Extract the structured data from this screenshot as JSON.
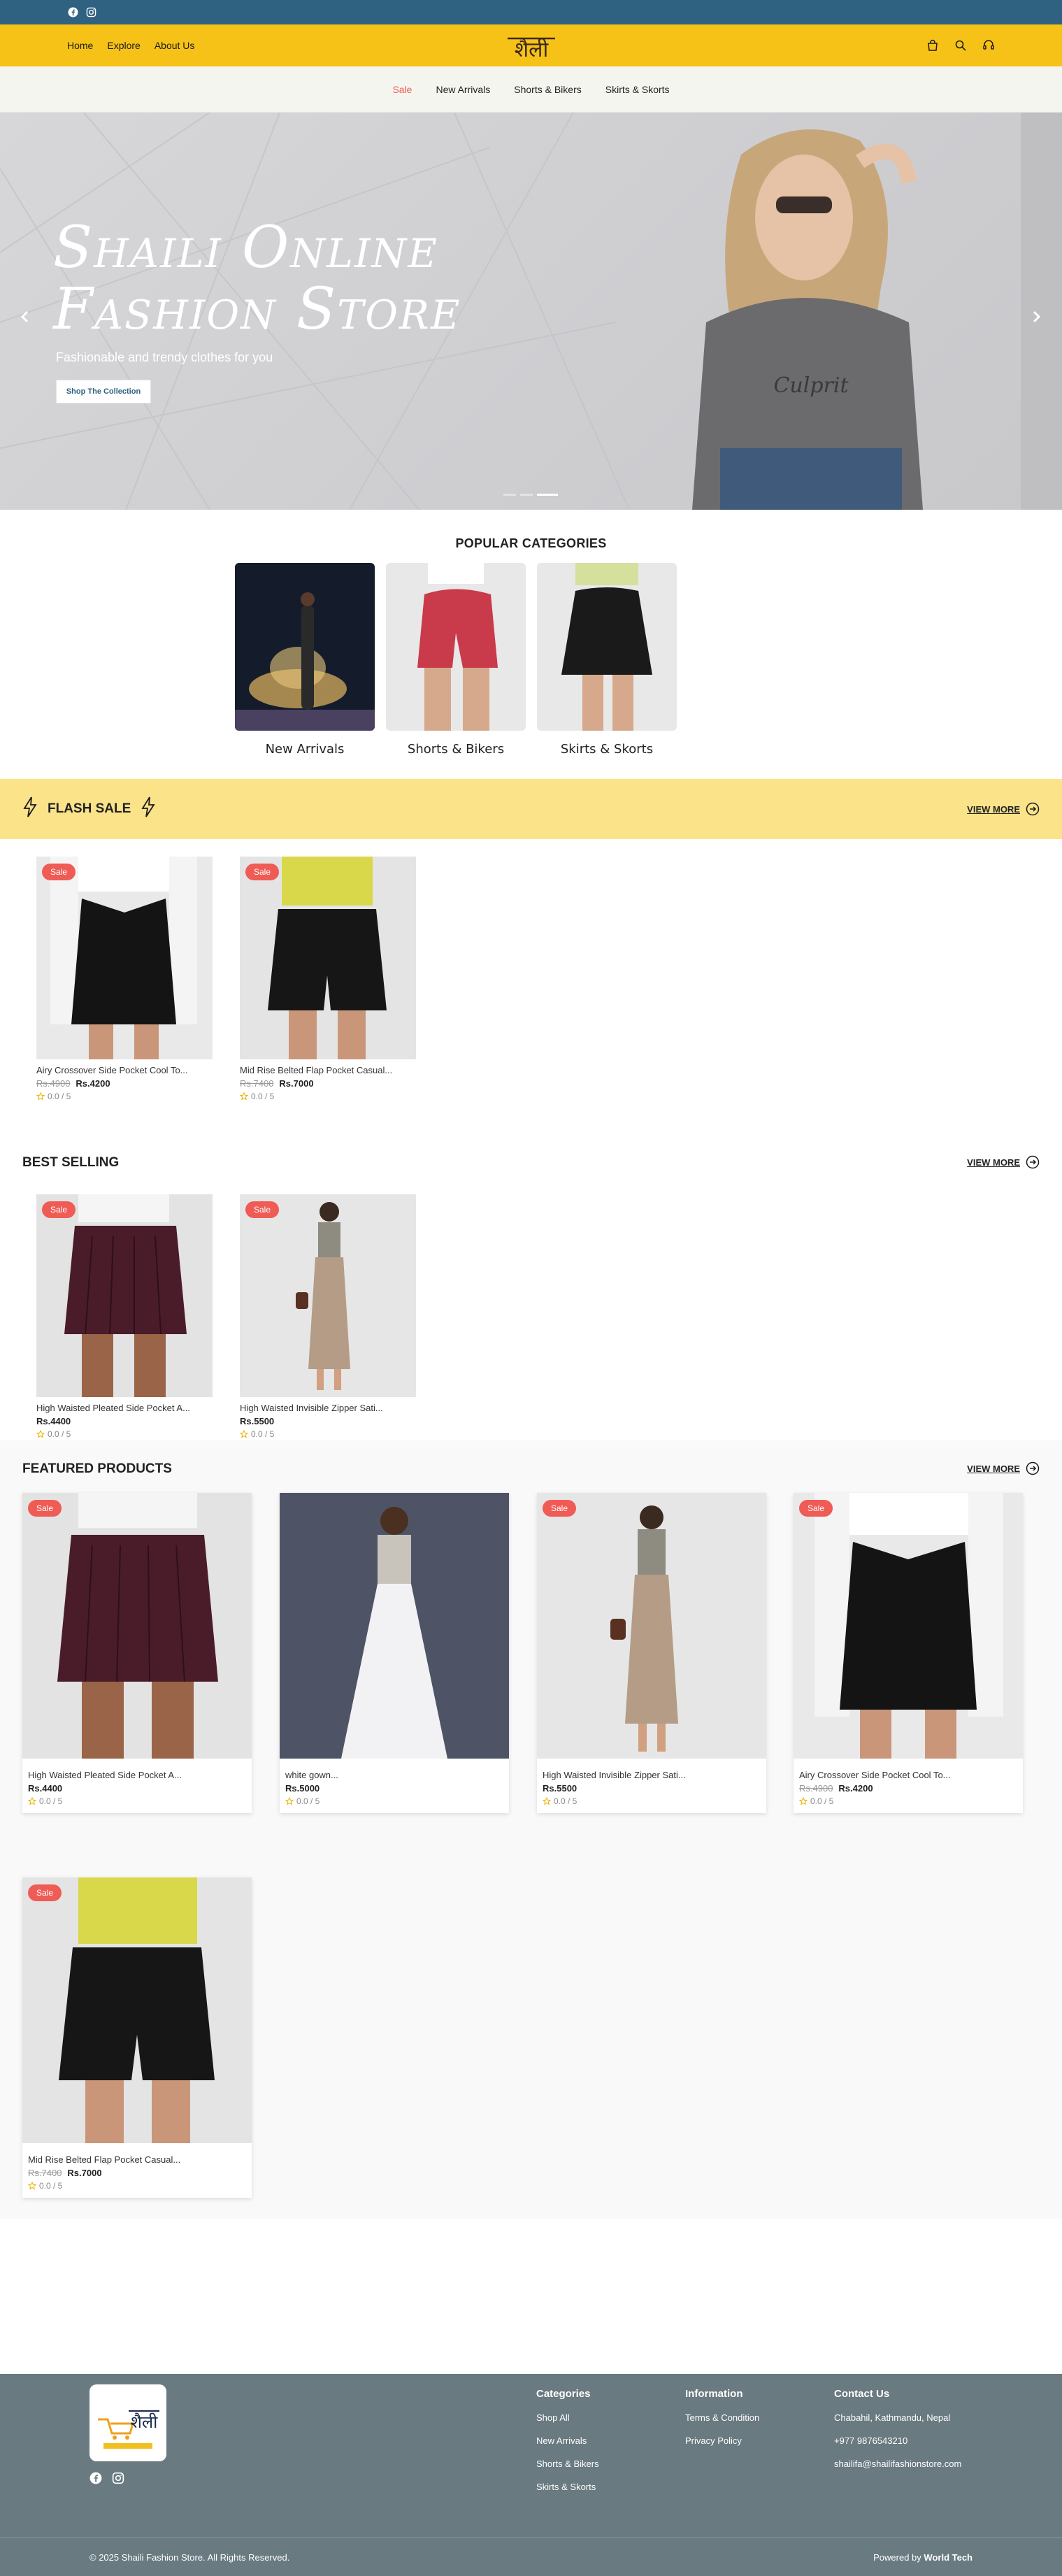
{
  "header": {
    "nav": [
      "Home",
      "Explore",
      "About Us"
    ],
    "logo_text": "शैली"
  },
  "catnav": {
    "items": [
      "Sale",
      "New Arrivals",
      "Shorts & Bikers",
      "Skirts & Skorts"
    ],
    "active": "Sale"
  },
  "hero": {
    "title_line1": "Shaili Online",
    "title_line2": "Fashion Store",
    "subtitle": "Fashionable and trendy clothes for you",
    "button": "Shop The Collection"
  },
  "popular": {
    "title": "POPULAR CATEGORIES",
    "items": [
      "New Arrivals",
      "Shorts & Bikers",
      "Skirts & Skorts"
    ]
  },
  "flash": {
    "title": "FLASH SALE",
    "view_more": "VIEW MORE",
    "products": [
      {
        "badge": "Sale",
        "name": "Airy Crossover Side Pocket Cool To...",
        "old_price": "Rs.4900",
        "price": "Rs.4200",
        "rating": "0.0 / 5"
      },
      {
        "badge": "Sale",
        "name": "Mid Rise Belted Flap Pocket Casual...",
        "old_price": "Rs.7400",
        "price": "Rs.7000",
        "rating": "0.0 / 5"
      }
    ]
  },
  "best": {
    "title": "BEST SELLING",
    "view_more": "VIEW MORE",
    "products": [
      {
        "badge": "Sale",
        "name": "High Waisted Pleated Side Pocket A...",
        "price": "Rs.4400",
        "rating": "0.0 / 5"
      },
      {
        "badge": "Sale",
        "name": "High Waisted Invisible Zipper Sati...",
        "price": "Rs.5500",
        "rating": "0.0 / 5"
      }
    ]
  },
  "featured": {
    "title": "FEATURED PRODUCTS",
    "view_more": "VIEW MORE",
    "products": [
      {
        "badge": "Sale",
        "name": "High Waisted Pleated Side Pocket A...",
        "price": "Rs.4400",
        "rating": "0.0 / 5"
      },
      {
        "badge": "",
        "name": "white gown...",
        "price": "Rs.5000",
        "rating": "0.0 / 5"
      },
      {
        "badge": "Sale",
        "name": "High Waisted Invisible Zipper Sati...",
        "price": "Rs.5500",
        "rating": "0.0 / 5"
      },
      {
        "badge": "Sale",
        "name": "Airy Crossover Side Pocket Cool To...",
        "old_price": "Rs.4900",
        "price": "Rs.4200",
        "rating": "0.0 / 5"
      },
      {
        "badge": "Sale",
        "name": "Mid Rise Belted Flap Pocket Casual...",
        "old_price": "Rs.7400",
        "price": "Rs.7000",
        "rating": "0.0 / 5"
      }
    ]
  },
  "footer": {
    "categories_title": "Categories",
    "categories": [
      "Shop All",
      "New Arrivals",
      "Shorts & Bikers",
      "Skirts & Skorts"
    ],
    "info_title": "Information",
    "info": [
      "Terms & Condition",
      "Privacy Policy"
    ],
    "contact_title": "Contact Us",
    "contact": [
      "Chabahil, Kathmandu, Nepal",
      "+977 9876543210",
      "shailifa@shailifashionstore.com"
    ],
    "copyright": "© 2025 Shaili Fashion Store. All Rights Reserved.",
    "powered_prefix": "Powered by",
    "powered_by": "World Tech"
  },
  "colors": {
    "topbar": "#2f6180",
    "header": "#f6c218",
    "accent": "#ef5b55",
    "flash_bg": "#fbe38a",
    "footer": "#697a80"
  }
}
